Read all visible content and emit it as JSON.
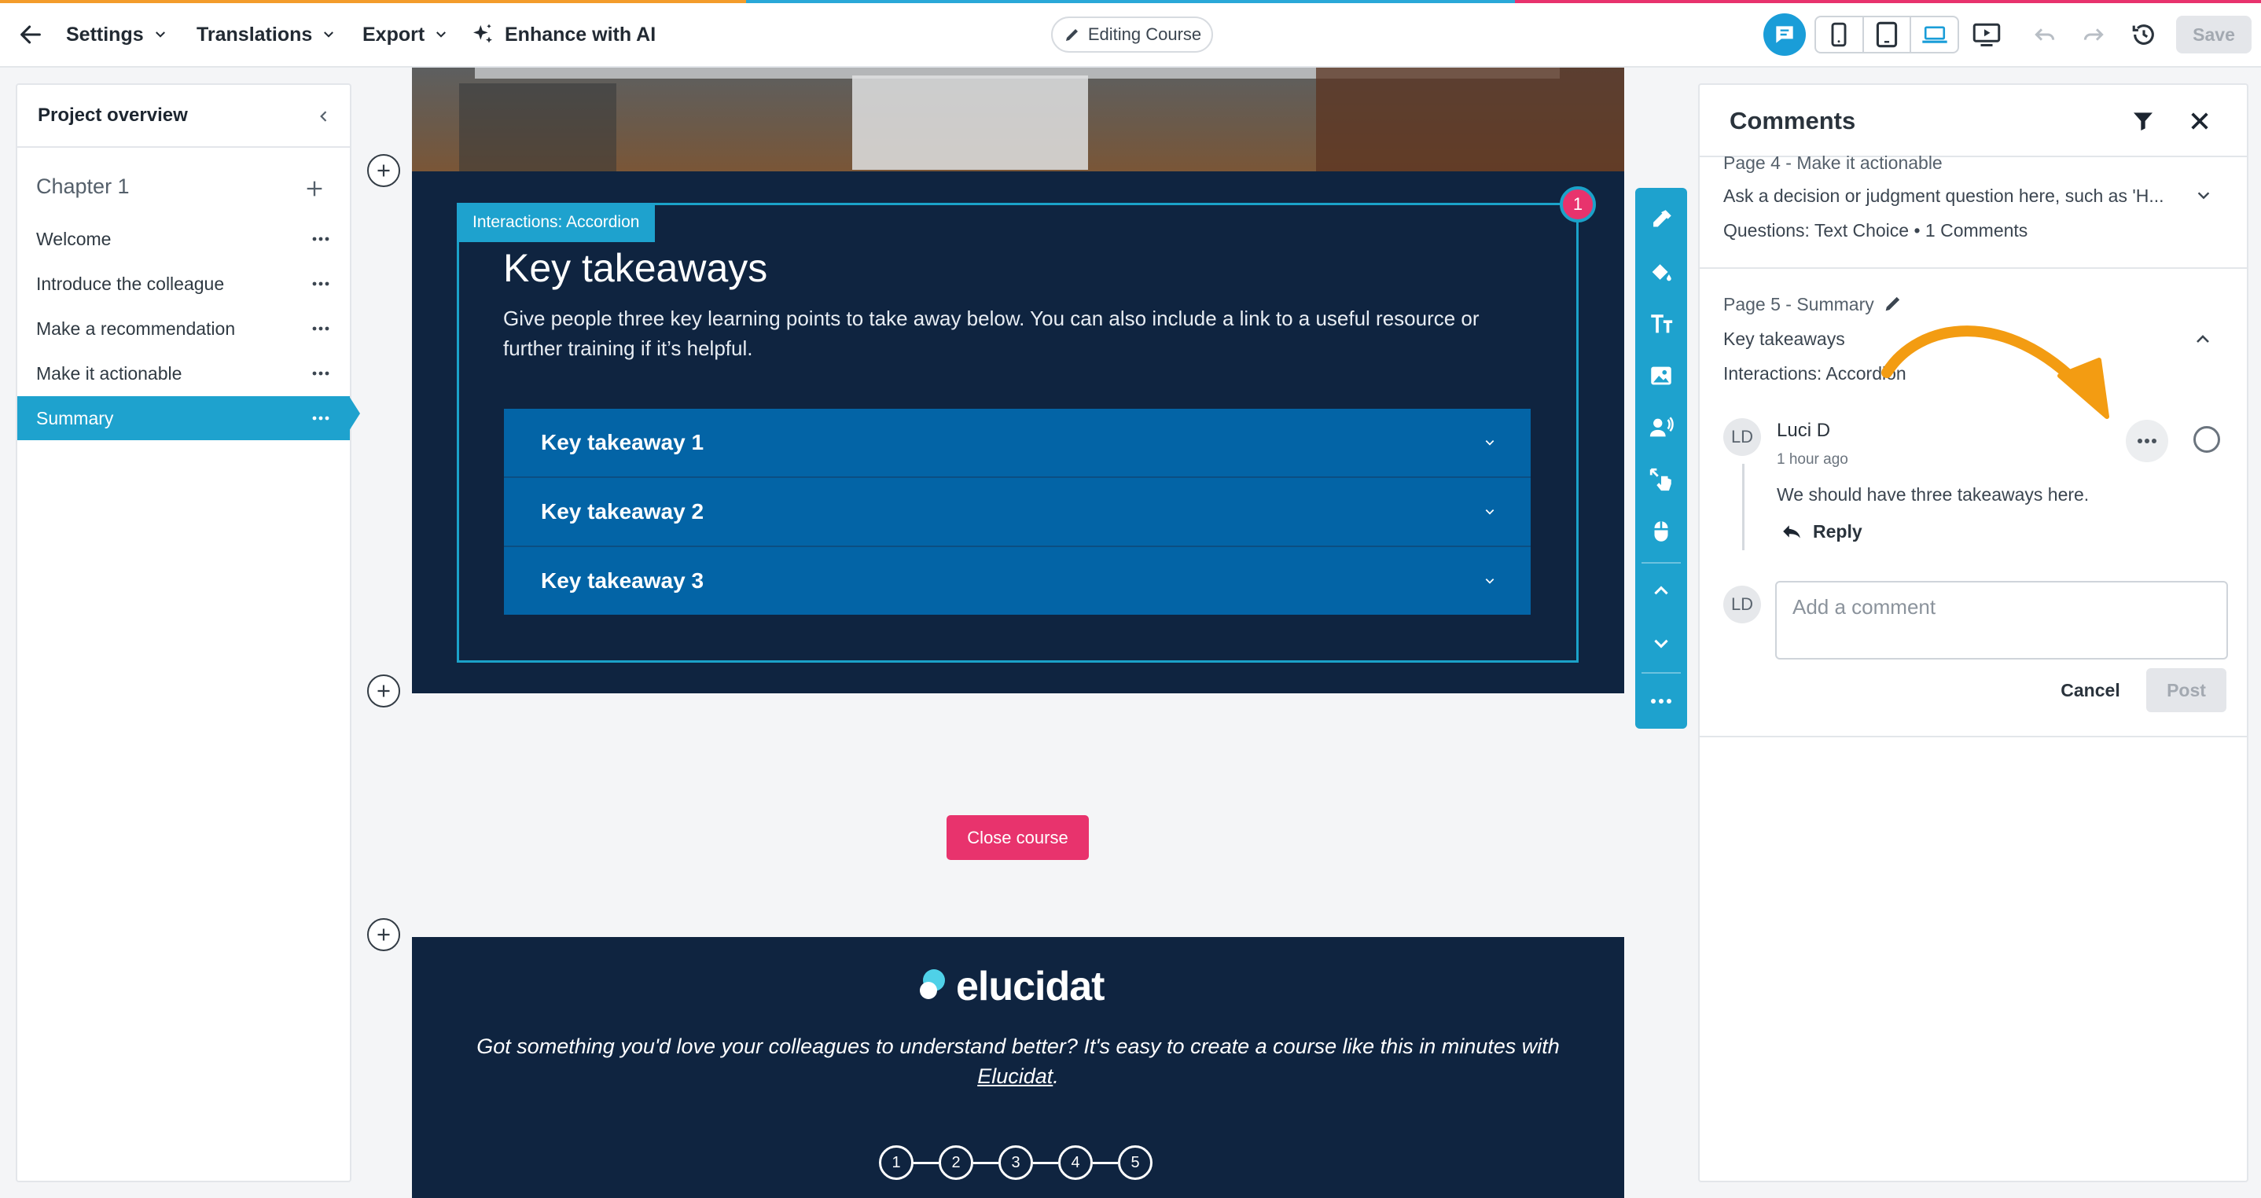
{
  "topbar": {
    "nav": [
      "Settings",
      "Translations",
      "Export"
    ],
    "enhance_label": "Enhance with AI",
    "mode_label": "Editing Course",
    "save_label": "Save"
  },
  "left_panel": {
    "title": "Project overview",
    "chapter": "Chapter 1",
    "pages": [
      "Welcome",
      "Introduce the colleague",
      "Make a recommendation",
      "Make it actionable",
      "Summary"
    ],
    "active_page": "Summary"
  },
  "canvas": {
    "interaction_tag": "Interactions: Accordion",
    "badge_count": "1",
    "title": "Key takeaways",
    "description": "Give people three key learning points to take away below. You can also include a link to a useful resource or further training if it’s helpful.",
    "accordion": [
      "Key takeaway 1",
      "Key takeaway 2",
      "Key takeaway 3"
    ],
    "close_button": "Close course",
    "footer": {
      "logo_text": "elucidat",
      "text_before": "Got something you'd love your colleagues to understand better? It's easy to create a course like this in minutes with ",
      "link_text": "Elucidat",
      "text_after": ".",
      "steps": [
        "1",
        "2",
        "3",
        "4",
        "5"
      ]
    }
  },
  "comments": {
    "title": "Comments",
    "prev_thread": {
      "page": "Page 4 - Make it actionable",
      "question": "Ask a decision or judgment question here, such as 'H...",
      "meta": "Questions: Text Choice • 1 Comments"
    },
    "thread": {
      "page": "Page 5 - Summary",
      "title": "Key takeaways",
      "interaction": "Interactions: Accordion",
      "comment": {
        "initials": "LD",
        "author": "Luci D",
        "time": "1 hour ago",
        "text": "We should have three takeaways here.",
        "reply_label": "Reply"
      },
      "new_comment": {
        "initials": "LD",
        "placeholder": "Add a comment",
        "cancel_label": "Cancel",
        "post_label": "Post"
      }
    }
  },
  "colors": {
    "accent": "#1ea2ce",
    "navy": "#0f2440",
    "accordion": "#0364a6",
    "pink": "#e8336d",
    "arrow": "#f39c12"
  }
}
